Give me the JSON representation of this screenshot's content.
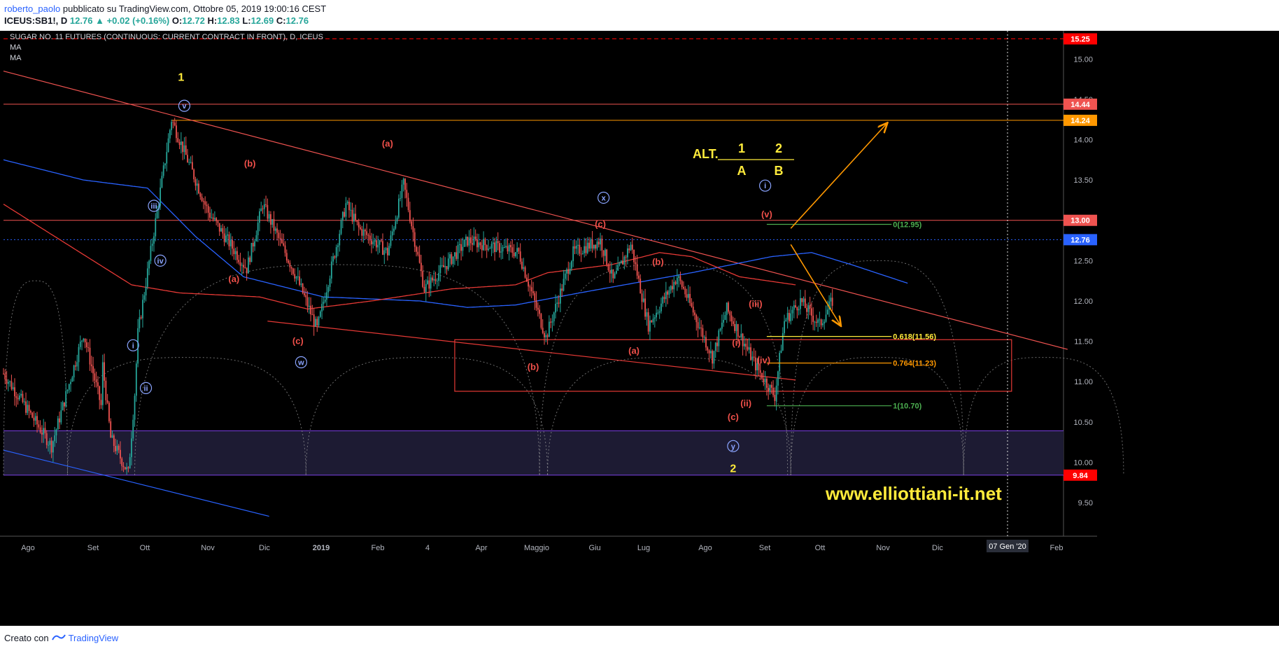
{
  "header": {
    "author": "roberto_paolo",
    "published": "pubblicato su TradingView.com, Ottobre 05, 2019 19:00:16 CEST",
    "symbol": "ICEUS:SB1!, D",
    "last": "12.76",
    "change": "+0.02 (+0.16%)",
    "open_label": "O:",
    "open": "12.72",
    "high_label": "H:",
    "high": "12.83",
    "low_label": "L:",
    "low": "12.69",
    "close_label": "C:",
    "close": "12.76"
  },
  "footer": {
    "created_with": "Creato con",
    "brand": "TradingView"
  },
  "colors": {
    "background": "#000000",
    "up_candle": "#26a69a",
    "down_candle": "#ef5350",
    "ma_blue": "#2962ff",
    "ma_red": "#e53935",
    "wave_red": "#f0504a",
    "wave_blue": "#8aa4ff",
    "yellow": "#ffeb3b",
    "orange": "#ff9800",
    "green": "#4caf50",
    "purple": "#7b3fe4"
  },
  "chart_data": {
    "type": "candlestick",
    "title": "SUGAR NO. 11 FUTURES (CONTINUOUS: CURRENT CONTRACT IN FRONT), D, ICEUS",
    "indicators": [
      "MA",
      "MA"
    ],
    "ylim": [
      9.3,
      15.35
    ],
    "yticks": [
      "15.00",
      "14.50",
      "14.00",
      "13.50",
      "13.00",
      "12.50",
      "12.00",
      "11.50",
      "11.00",
      "10.50",
      "10.00",
      "9.50"
    ],
    "xtick_labels": [
      "Ago",
      "Set",
      "Ott",
      "Nov",
      "Dic",
      "2019",
      "Feb",
      "4",
      "Apr",
      "Maggio",
      "Giu",
      "Lug",
      "Ago",
      "Set",
      "Ott",
      "Nov",
      "Dic",
      "Feb"
    ],
    "x_cursor_label": "07 Gen '20",
    "price_tags": [
      {
        "value": 15.25,
        "label": "15.25",
        "color": "#ff0000"
      },
      {
        "value": 14.44,
        "label": "14.44",
        "color": "#ef5350"
      },
      {
        "value": 14.24,
        "label": "14.24",
        "color": "#ff9800"
      },
      {
        "value": 13.0,
        "label": "13.00",
        "color": "#ef5350"
      },
      {
        "value": 12.76,
        "label": "12.76",
        "color": "#2962ff"
      },
      {
        "value": 9.84,
        "label": "9.84",
        "color": "#ff0000"
      }
    ],
    "swing_path": [
      [
        0,
        11.1
      ],
      [
        30,
        10.2
      ],
      [
        50,
        11.6
      ],
      [
        61,
        10.7
      ],
      [
        62,
        11.2
      ],
      [
        67,
        10.3
      ],
      [
        78,
        9.86
      ],
      [
        82,
        10.85
      ],
      [
        84,
        11.6
      ],
      [
        105,
        14.25
      ],
      [
        128,
        13.1
      ],
      [
        152,
        12.4
      ],
      [
        162,
        13.2
      ],
      [
        183,
        12.3
      ],
      [
        196,
        11.65
      ],
      [
        214,
        13.2
      ],
      [
        222,
        12.9
      ],
      [
        240,
        12.6
      ],
      [
        250,
        13.45
      ],
      [
        263,
        12.15
      ],
      [
        290,
        12.75
      ],
      [
        322,
        12.6
      ],
      [
        339,
        11.55
      ],
      [
        356,
        12.6
      ],
      [
        373,
        12.75
      ],
      [
        381,
        12.25
      ],
      [
        392,
        12.7
      ],
      [
        403,
        11.7
      ],
      [
        421,
        12.3
      ],
      [
        425,
        12.15
      ],
      [
        443,
        11.3
      ],
      [
        452,
        11.9
      ],
      [
        470,
        11.2
      ],
      [
        482,
        10.82
      ],
      [
        488,
        11.75
      ],
      [
        498,
        12.0
      ],
      [
        510,
        11.7
      ],
      [
        518,
        12.0
      ]
    ],
    "ma_long": [
      [
        0,
        13.75
      ],
      [
        50,
        13.5
      ],
      [
        90,
        13.4
      ],
      [
        120,
        12.8
      ],
      [
        150,
        12.3
      ],
      [
        200,
        12.05
      ],
      [
        260,
        12.0
      ],
      [
        290,
        11.92
      ],
      [
        320,
        11.95
      ],
      [
        360,
        12.1
      ],
      [
        430,
        12.35
      ],
      [
        480,
        12.55
      ],
      [
        505,
        12.6
      ],
      [
        530,
        12.45
      ],
      [
        565,
        12.22
      ]
    ],
    "ma_short": [
      [
        0,
        13.2
      ],
      [
        40,
        12.7
      ],
      [
        80,
        12.2
      ],
      [
        110,
        12.1
      ],
      [
        160,
        12.05
      ],
      [
        190,
        11.9
      ],
      [
        230,
        12.0
      ],
      [
        280,
        12.15
      ],
      [
        320,
        12.2
      ],
      [
        340,
        12.35
      ],
      [
        380,
        12.45
      ],
      [
        410,
        12.6
      ],
      [
        430,
        12.55
      ],
      [
        460,
        12.3
      ],
      [
        495,
        12.2
      ]
    ],
    "trendlines": [
      {
        "name": "upper-trendline",
        "from": [
          0,
          14.85
        ],
        "to": [
          665,
          11.4
        ],
        "color": "#ef5350"
      },
      {
        "name": "lower-trendline",
        "from": [
          165,
          11.75
        ],
        "to": [
          495,
          11.02
        ],
        "color": "#e53935"
      },
      {
        "name": "channel-line",
        "from": [
          0,
          10.15
        ],
        "to": [
          166,
          9.33
        ],
        "color": "#2962ff"
      }
    ],
    "horizontal_levels": [
      {
        "value": 15.25,
        "color": "#ff0000",
        "dashed": true
      },
      {
        "value": 14.44,
        "color": "#ef5350"
      },
      {
        "value": 13.0,
        "color": "#ef5350"
      },
      {
        "value": 12.76,
        "color": "#2962ff",
        "dotted": true
      },
      {
        "value": 14.24,
        "color": "#ff9800",
        "from": 105
      }
    ],
    "support_zone": {
      "from": 10.39,
      "to": 9.84,
      "label_color": "#7b3fe4"
    },
    "rect_zone": {
      "x0": 282,
      "x1": 630,
      "y_top": 11.52,
      "y_bottom": 10.88
    },
    "fib_levels": [
      {
        "label": "0(12.95)",
        "value": 12.95,
        "color": "#4caf50",
        "x0": 477,
        "x1": 555
      },
      {
        "label": "0.618(11.56)",
        "value": 11.56,
        "color": "#ffeb3b",
        "x0": 477,
        "x1": 555
      },
      {
        "label": "0.764(11.23)",
        "value": 11.23,
        "color": "#ff9800",
        "x0": 477,
        "x1": 555
      },
      {
        "label": "1(10.70)",
        "value": 10.7,
        "color": "#4caf50",
        "x0": 477,
        "x1": 555
      }
    ],
    "arrows": [
      {
        "from": [
          492,
          12.9
        ],
        "to": [
          552,
          14.2
        ],
        "color": "#ff9800"
      },
      {
        "from": [
          492,
          12.7
        ],
        "to": [
          523,
          11.7
        ],
        "color": "#ff9800"
      }
    ],
    "cycle_arcs": [
      {
        "x0": 0,
        "x1": 40,
        "peak": 12.25
      },
      {
        "x0": 40,
        "x1": 189,
        "peak": 11.3
      },
      {
        "x0": 82,
        "x1": 335,
        "peak": 12.45
      },
      {
        "x0": 189,
        "x1": 340,
        "peak": 11.3
      },
      {
        "x0": 335,
        "x1": 490,
        "peak": 12.45
      },
      {
        "x0": 340,
        "x1": 492,
        "peak": 11.3
      },
      {
        "x0": 492,
        "x1": 600,
        "peak": 12.5
      },
      {
        "x0": 492,
        "x1": 600,
        "peak": 11.3
      },
      {
        "x0": 600,
        "x1": 700,
        "peak": 11.3
      }
    ],
    "wave_labels": [
      {
        "text": "1",
        "x": 111,
        "y": 14.78,
        "style": "yellow"
      },
      {
        "text": "v",
        "x": 113,
        "y": 14.42,
        "style": "circle"
      },
      {
        "text": "iii",
        "x": 94,
        "y": 13.18,
        "style": "circle"
      },
      {
        "text": "iv",
        "x": 98,
        "y": 12.5,
        "style": "circle"
      },
      {
        "text": "i",
        "x": 81,
        "y": 11.45,
        "style": "circle"
      },
      {
        "text": "ii",
        "x": 89,
        "y": 10.92,
        "style": "circle"
      },
      {
        "text": "(b)",
        "x": 154,
        "y": 13.7,
        "style": "red"
      },
      {
        "text": "(a)",
        "x": 144,
        "y": 12.27,
        "style": "red"
      },
      {
        "text": "(c)",
        "x": 184,
        "y": 11.5,
        "style": "red"
      },
      {
        "text": "w",
        "x": 186,
        "y": 11.24,
        "style": "circle"
      },
      {
        "text": "(a)",
        "x": 240,
        "y": 13.95,
        "style": "red"
      },
      {
        "text": "(b)",
        "x": 331,
        "y": 11.18,
        "style": "red"
      },
      {
        "text": "x",
        "x": 375,
        "y": 13.28,
        "style": "circle"
      },
      {
        "text": "(c)",
        "x": 373,
        "y": 12.95,
        "style": "red"
      },
      {
        "text": "(b)",
        "x": 409,
        "y": 12.48,
        "style": "red"
      },
      {
        "text": "(a)",
        "x": 394,
        "y": 11.38,
        "style": "red"
      },
      {
        "text": "(i)",
        "x": 458,
        "y": 11.48,
        "style": "red"
      },
      {
        "text": "(ii)",
        "x": 464,
        "y": 10.73,
        "style": "red"
      },
      {
        "text": "(c)",
        "x": 456,
        "y": 10.56,
        "style": "red"
      },
      {
        "text": "(iii)",
        "x": 470,
        "y": 11.96,
        "style": "red"
      },
      {
        "text": "(iv)",
        "x": 475,
        "y": 11.26,
        "style": "red"
      },
      {
        "text": "(v)",
        "x": 477,
        "y": 13.07,
        "style": "red"
      },
      {
        "text": "i",
        "x": 476,
        "y": 13.43,
        "style": "circle"
      },
      {
        "text": "y",
        "x": 456,
        "y": 10.2,
        "style": "circle"
      },
      {
        "text": "2",
        "x": 456,
        "y": 9.93,
        "style": "yellow"
      }
    ],
    "alt_box": {
      "prefix": "ALT.",
      "top": [
        "1",
        "2"
      ],
      "bottom": [
        "A",
        "B"
      ]
    },
    "watermark": "www.elliottiani-it.net"
  }
}
